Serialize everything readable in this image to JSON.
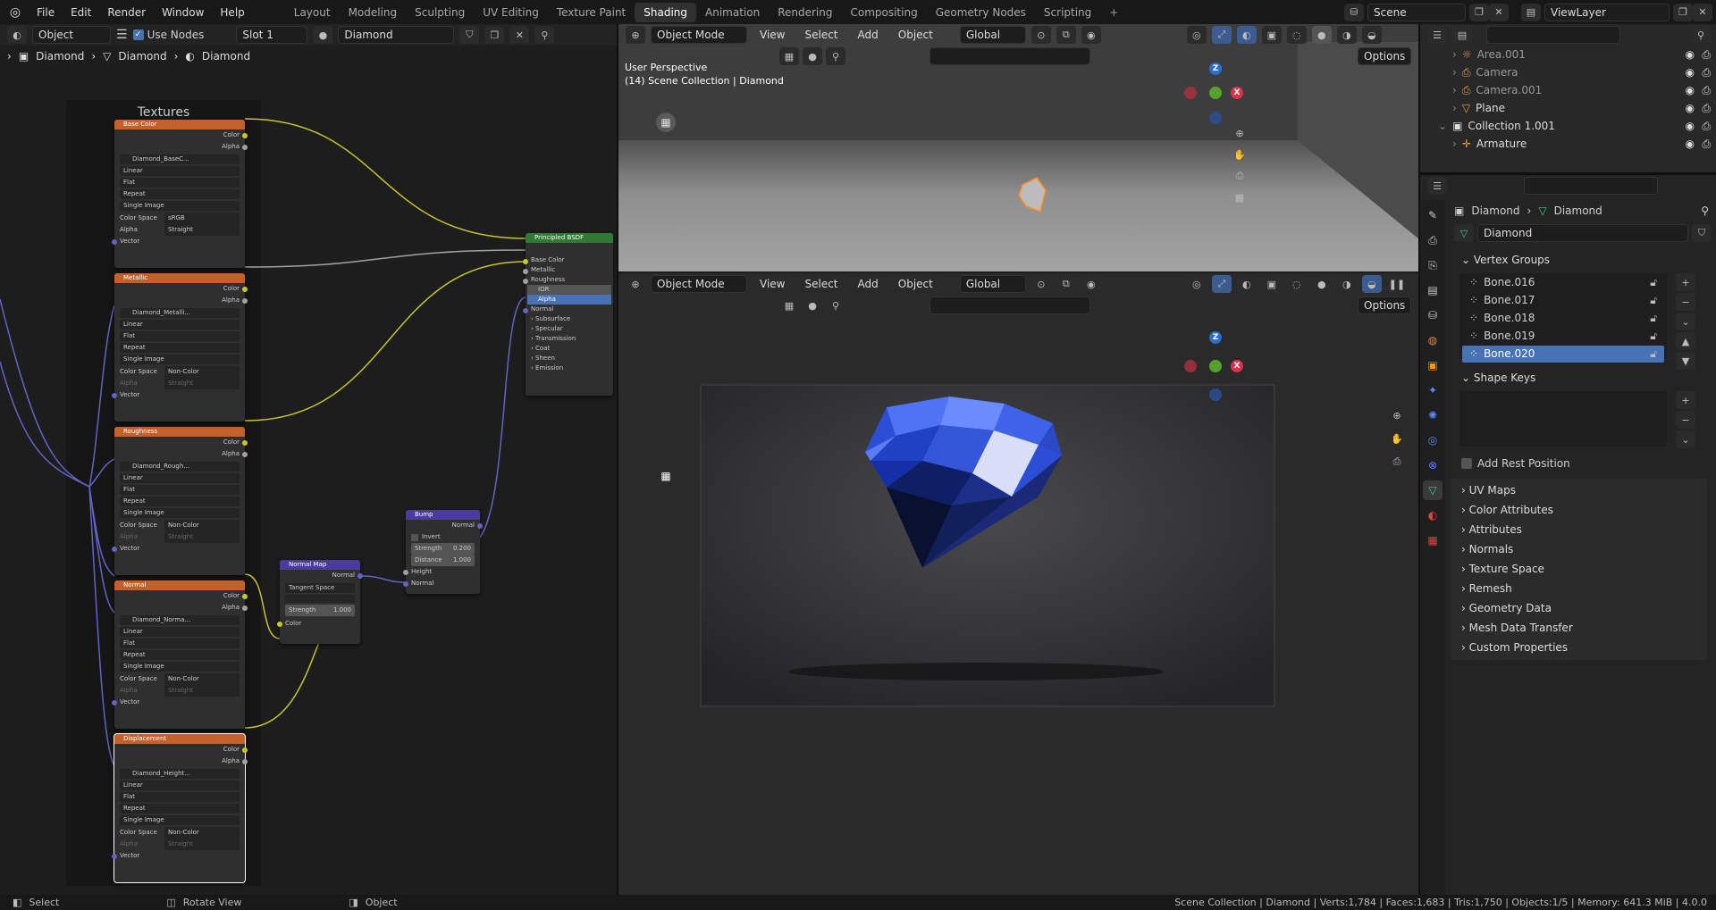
{
  "topbar": {
    "menus": [
      "File",
      "Edit",
      "Render",
      "Window",
      "Help"
    ],
    "workspaces": [
      "Layout",
      "Modeling",
      "Sculpting",
      "UV Editing",
      "Texture Paint",
      "Shading",
      "Animation",
      "Rendering",
      "Compositing",
      "Geometry Nodes",
      "Scripting",
      "+"
    ],
    "active_workspace": "Shading",
    "scene": "Scene",
    "view_layer": "ViewLayer"
  },
  "node_editor": {
    "mode": "Object",
    "use_nodes": "Use Nodes",
    "slot": "Slot 1",
    "material": "Diamond",
    "breadcrumb": [
      "Diamond",
      "Diamond",
      "Diamond"
    ],
    "frame_title": "Textures",
    "tex_nodes": [
      {
        "title": "Base Color",
        "image": "Diamond_BaseC...",
        "colorspace": "sRGB",
        "alpha": "Straight"
      },
      {
        "title": "Metallic",
        "image": "Diamond_Metalli...",
        "colorspace": "Non-Color",
        "alpha": "Straight"
      },
      {
        "title": "Roughness",
        "image": "Diamond_Rough...",
        "colorspace": "Non-Color",
        "alpha": "Straight"
      },
      {
        "title": "Normal",
        "image": "Diamond_Norma...",
        "colorspace": "Non-Color",
        "alpha": "Straight"
      },
      {
        "title": "Displacement",
        "image": "Diamond_Height...",
        "colorspace": "Non-Color",
        "alpha": "Straight"
      }
    ],
    "tex_labels": {
      "color": "Color",
      "alpha": "Alpha",
      "interp": "Linear",
      "proj": "Flat",
      "ext": "Repeat",
      "source": "Single Image",
      "colorspace_label": "Color Space",
      "alpha_label": "Alpha",
      "vector": "Vector"
    },
    "bsdf": {
      "title": "Principled BSDF",
      "inputs": [
        "Base Color",
        "Metallic",
        "Roughness",
        "IOR",
        "Alpha",
        "Normal"
      ],
      "panels": [
        "Subsurface",
        "Specular",
        "Transmission",
        "Coat",
        "Sheen",
        "Emission"
      ]
    },
    "normal_map": {
      "title": "Normal Map",
      "out": "Normal",
      "space": "Tangent Space",
      "strength_label": "Strength",
      "strength": "1.000",
      "color": "Color"
    },
    "bump": {
      "title": "Bump",
      "out": "Normal",
      "invert": "Invert",
      "strength_label": "Strength",
      "strength": "0.200",
      "distance_label": "Distance",
      "distance": "1.000",
      "height": "Height",
      "normal": "Normal"
    }
  },
  "viewport_top": {
    "mode": "Object Mode",
    "menus": [
      "View",
      "Select",
      "Add",
      "Object"
    ],
    "orientation": "Global",
    "options": "Options",
    "perspective": "User Perspective",
    "collection": "(14) Scene Collection | Diamond"
  },
  "viewport_bottom": {
    "mode": "Object Mode",
    "menus": [
      "View",
      "Select",
      "Add",
      "Object"
    ],
    "orientation": "Global",
    "options": "Options"
  },
  "outliner": {
    "items": [
      "Area.001",
      "Camera",
      "Camera.001",
      "Plane",
      "Collection 1.001",
      "Armature"
    ]
  },
  "properties": {
    "breadcrumb": [
      "Diamond",
      "Diamond"
    ],
    "mesh_name": "Diamond",
    "vertex_groups_title": "Vertex Groups",
    "vertex_groups": [
      "Bone.016",
      "Bone.017",
      "Bone.018",
      "Bone.019",
      "Bone.020"
    ],
    "active_group": "Bone.020",
    "shape_keys_title": "Shape Keys",
    "add_rest_position": "Add Rest Position",
    "sections": [
      "UV Maps",
      "Color Attributes",
      "Attributes",
      "Normals",
      "Texture Space",
      "Remesh",
      "Geometry Data",
      "Mesh Data Transfer",
      "Custom Properties"
    ]
  },
  "statusbar": {
    "select": "Select",
    "rotate": "Rotate View",
    "object": "Object",
    "stats": "Scene Collection | Diamond | Verts:1,784 | Faces:1,683 | Tris:1,750 | Objects:1/5 | Memory: 641.3 MiB | 4.0.0"
  },
  "colors": {
    "accent": "#4772b3",
    "texture_header": "#c3612a",
    "shader_header": "#2f7a32",
    "vector_header": "#4a3b9c",
    "gem": "#2a4fd6"
  }
}
